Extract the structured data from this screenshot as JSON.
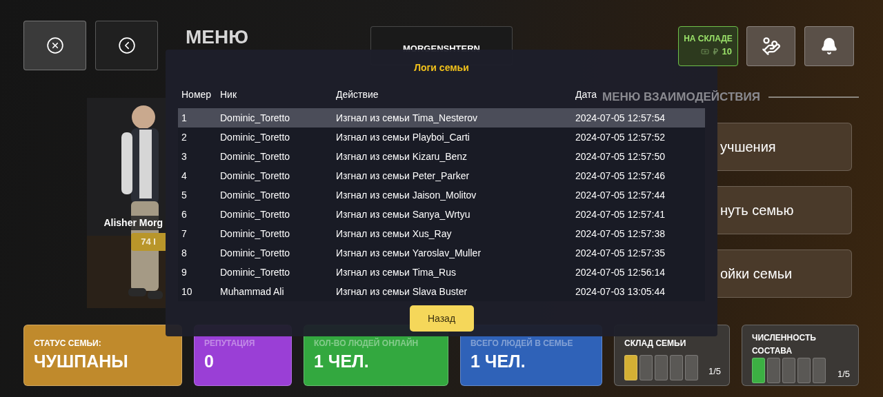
{
  "title": "МЕНЮ",
  "family_name": "MORGENSHTERN",
  "storage_badge": {
    "label": "НА СКЛАДЕ",
    "currency": "₽",
    "value": "10"
  },
  "player": {
    "name": "Alisher Morg",
    "id": "74 I"
  },
  "interaction_menu": {
    "title": "МЕНЮ ВЗАИМОДЕЙСТВИЯ",
    "items": [
      "учшения",
      "нуть семью",
      "ойки семьи"
    ]
  },
  "stats": [
    {
      "kind": "text",
      "label": "СТАТУС СЕМЬИ:",
      "value": "ЧУШПАНЫ",
      "color": "#c08a2c"
    },
    {
      "kind": "text",
      "label": "РЕПУТАЦИЯ",
      "value": "0",
      "color": "#9a3fd6"
    },
    {
      "kind": "text",
      "label": "КОЛ-ВО ЛЮДЕЙ ОНЛАЙН",
      "value": "1 ЧЕЛ.",
      "color": "#33a83f"
    },
    {
      "kind": "text",
      "label": "ВСЕГО ЛЮДЕЙ В СЕМЬЕ",
      "value": "1 ЧЕЛ.",
      "color": "#2f62b8"
    },
    {
      "kind": "slots",
      "label": "СКЛАД СЕМЬИ",
      "count": "1/5",
      "color": "#d4b034",
      "slots": [
        {
          "filled": true
        },
        {
          "filled": false
        },
        {
          "filled": false
        },
        {
          "filled": false
        },
        {
          "filled": false
        }
      ]
    },
    {
      "kind": "slots",
      "label": "ЧИСЛЕННОСТЬ СОСТАВА",
      "count": "1/5",
      "color": "#3cb043",
      "slots": [
        {
          "filled": true
        },
        {
          "filled": false
        },
        {
          "filled": false
        },
        {
          "filled": false
        },
        {
          "filled": false
        }
      ]
    }
  ],
  "log_dialog": {
    "title": "Логи семьи",
    "columns": [
      "Номер",
      "Ник",
      "Действие",
      "Дата"
    ],
    "rows": [
      {
        "selected": true,
        "cells": [
          "1",
          "Dominic_Toretto",
          "Изгнал из семьи Tima_Nesterov",
          "2024-07-05 12:57:54"
        ]
      },
      {
        "selected": false,
        "cells": [
          "2",
          "Dominic_Toretto",
          "Изгнал из семьи Playboi_Carti",
          "2024-07-05 12:57:52"
        ]
      },
      {
        "selected": false,
        "cells": [
          "3",
          "Dominic_Toretto",
          "Изгнал из семьи Kizaru_Benz",
          "2024-07-05 12:57:50"
        ]
      },
      {
        "selected": false,
        "cells": [
          "4",
          "Dominic_Toretto",
          "Изгнал из семьи Peter_Parker",
          "2024-07-05 12:57:46"
        ]
      },
      {
        "selected": false,
        "cells": [
          "5",
          "Dominic_Toretto",
          "Изгнал из семьи Jaison_Molitov",
          "2024-07-05 12:57:44"
        ]
      },
      {
        "selected": false,
        "cells": [
          "6",
          "Dominic_Toretto",
          "Изгнал из семьи Sanya_Wrtyu",
          "2024-07-05 12:57:41"
        ]
      },
      {
        "selected": false,
        "cells": [
          "7",
          "Dominic_Toretto",
          "Изгнал из семьи Xus_Ray",
          "2024-07-05 12:57:38"
        ]
      },
      {
        "selected": false,
        "cells": [
          "8",
          "Dominic_Toretto",
          "Изгнал из семьи Yaroslav_Muller",
          "2024-07-05 12:57:35"
        ]
      },
      {
        "selected": false,
        "cells": [
          "9",
          "Dominic_Toretto",
          "Изгнал из семьи Tima_Rus",
          "2024-07-05 12:56:14"
        ]
      },
      {
        "selected": false,
        "cells": [
          "10",
          "Muhammad Ali",
          "Изгнал из семьи Slava Buster",
          "2024-07-03 13:05:44"
        ]
      }
    ],
    "back_button": "Назад"
  }
}
